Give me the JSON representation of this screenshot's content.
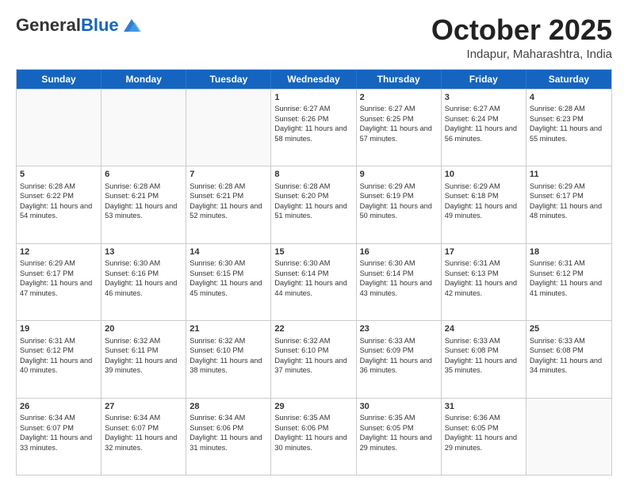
{
  "header": {
    "logo_general": "General",
    "logo_blue": "Blue",
    "month_title": "October 2025",
    "location": "Indapur, Maharashtra, India"
  },
  "weekdays": [
    "Sunday",
    "Monday",
    "Tuesday",
    "Wednesday",
    "Thursday",
    "Friday",
    "Saturday"
  ],
  "rows": [
    [
      {
        "day": "",
        "info": ""
      },
      {
        "day": "",
        "info": ""
      },
      {
        "day": "",
        "info": ""
      },
      {
        "day": "1",
        "info": "Sunrise: 6:27 AM\nSunset: 6:26 PM\nDaylight: 11 hours and 58 minutes."
      },
      {
        "day": "2",
        "info": "Sunrise: 6:27 AM\nSunset: 6:25 PM\nDaylight: 11 hours and 57 minutes."
      },
      {
        "day": "3",
        "info": "Sunrise: 6:27 AM\nSunset: 6:24 PM\nDaylight: 11 hours and 56 minutes."
      },
      {
        "day": "4",
        "info": "Sunrise: 6:28 AM\nSunset: 6:23 PM\nDaylight: 11 hours and 55 minutes."
      }
    ],
    [
      {
        "day": "5",
        "info": "Sunrise: 6:28 AM\nSunset: 6:22 PM\nDaylight: 11 hours and 54 minutes."
      },
      {
        "day": "6",
        "info": "Sunrise: 6:28 AM\nSunset: 6:21 PM\nDaylight: 11 hours and 53 minutes."
      },
      {
        "day": "7",
        "info": "Sunrise: 6:28 AM\nSunset: 6:21 PM\nDaylight: 11 hours and 52 minutes."
      },
      {
        "day": "8",
        "info": "Sunrise: 6:28 AM\nSunset: 6:20 PM\nDaylight: 11 hours and 51 minutes."
      },
      {
        "day": "9",
        "info": "Sunrise: 6:29 AM\nSunset: 6:19 PM\nDaylight: 11 hours and 50 minutes."
      },
      {
        "day": "10",
        "info": "Sunrise: 6:29 AM\nSunset: 6:18 PM\nDaylight: 11 hours and 49 minutes."
      },
      {
        "day": "11",
        "info": "Sunrise: 6:29 AM\nSunset: 6:17 PM\nDaylight: 11 hours and 48 minutes."
      }
    ],
    [
      {
        "day": "12",
        "info": "Sunrise: 6:29 AM\nSunset: 6:17 PM\nDaylight: 11 hours and 47 minutes."
      },
      {
        "day": "13",
        "info": "Sunrise: 6:30 AM\nSunset: 6:16 PM\nDaylight: 11 hours and 46 minutes."
      },
      {
        "day": "14",
        "info": "Sunrise: 6:30 AM\nSunset: 6:15 PM\nDaylight: 11 hours and 45 minutes."
      },
      {
        "day": "15",
        "info": "Sunrise: 6:30 AM\nSunset: 6:14 PM\nDaylight: 11 hours and 44 minutes."
      },
      {
        "day": "16",
        "info": "Sunrise: 6:30 AM\nSunset: 6:14 PM\nDaylight: 11 hours and 43 minutes."
      },
      {
        "day": "17",
        "info": "Sunrise: 6:31 AM\nSunset: 6:13 PM\nDaylight: 11 hours and 42 minutes."
      },
      {
        "day": "18",
        "info": "Sunrise: 6:31 AM\nSunset: 6:12 PM\nDaylight: 11 hours and 41 minutes."
      }
    ],
    [
      {
        "day": "19",
        "info": "Sunrise: 6:31 AM\nSunset: 6:12 PM\nDaylight: 11 hours and 40 minutes."
      },
      {
        "day": "20",
        "info": "Sunrise: 6:32 AM\nSunset: 6:11 PM\nDaylight: 11 hours and 39 minutes."
      },
      {
        "day": "21",
        "info": "Sunrise: 6:32 AM\nSunset: 6:10 PM\nDaylight: 11 hours and 38 minutes."
      },
      {
        "day": "22",
        "info": "Sunrise: 6:32 AM\nSunset: 6:10 PM\nDaylight: 11 hours and 37 minutes."
      },
      {
        "day": "23",
        "info": "Sunrise: 6:33 AM\nSunset: 6:09 PM\nDaylight: 11 hours and 36 minutes."
      },
      {
        "day": "24",
        "info": "Sunrise: 6:33 AM\nSunset: 6:08 PM\nDaylight: 11 hours and 35 minutes."
      },
      {
        "day": "25",
        "info": "Sunrise: 6:33 AM\nSunset: 6:08 PM\nDaylight: 11 hours and 34 minutes."
      }
    ],
    [
      {
        "day": "26",
        "info": "Sunrise: 6:34 AM\nSunset: 6:07 PM\nDaylight: 11 hours and 33 minutes."
      },
      {
        "day": "27",
        "info": "Sunrise: 6:34 AM\nSunset: 6:07 PM\nDaylight: 11 hours and 32 minutes."
      },
      {
        "day": "28",
        "info": "Sunrise: 6:34 AM\nSunset: 6:06 PM\nDaylight: 11 hours and 31 minutes."
      },
      {
        "day": "29",
        "info": "Sunrise: 6:35 AM\nSunset: 6:06 PM\nDaylight: 11 hours and 30 minutes."
      },
      {
        "day": "30",
        "info": "Sunrise: 6:35 AM\nSunset: 6:05 PM\nDaylight: 11 hours and 29 minutes."
      },
      {
        "day": "31",
        "info": "Sunrise: 6:36 AM\nSunset: 6:05 PM\nDaylight: 11 hours and 29 minutes."
      },
      {
        "day": "",
        "info": ""
      }
    ]
  ]
}
